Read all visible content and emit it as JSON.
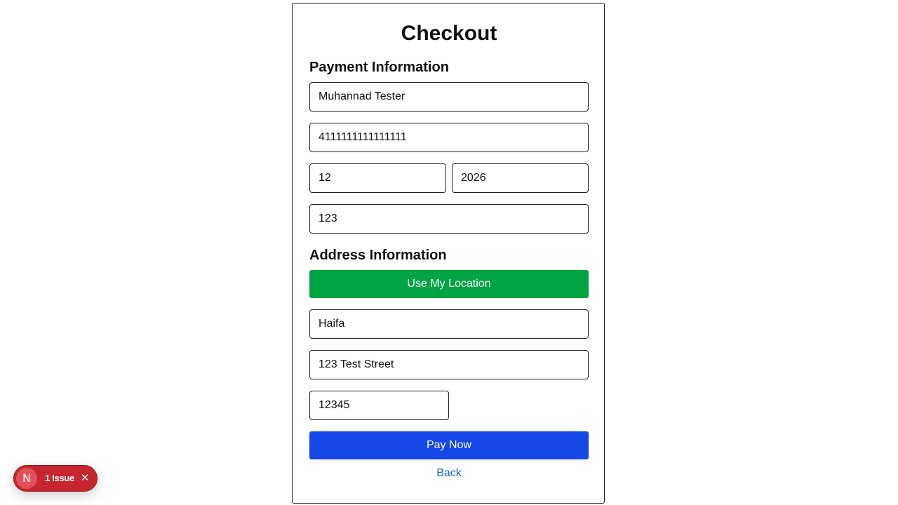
{
  "checkout": {
    "title": "Checkout",
    "payment": {
      "section_title": "Payment Information",
      "cardholder_name": "Muhannad Tester",
      "card_number": "4111111111111111",
      "expiry_month": "12",
      "expiry_year": "2026",
      "cvv": "123"
    },
    "address": {
      "section_title": "Address Information",
      "use_location_label": "Use My Location",
      "city": "Haifa",
      "street": "123 Test Street",
      "zip": "12345"
    },
    "pay_now_label": "Pay Now",
    "back_label": "Back"
  },
  "dev_overlay": {
    "logo_letter": "N",
    "issues_label": "1 Issue",
    "close_glyph": "✕"
  },
  "colors": {
    "location_button": "#00a443",
    "pay_button": "#1447e6",
    "back_link": "#1a5fe0",
    "issue_badge": "#c8262f"
  },
  "icons": {
    "issue_close": "close-icon",
    "overlay_logo": "nextjs-logo-icon"
  }
}
